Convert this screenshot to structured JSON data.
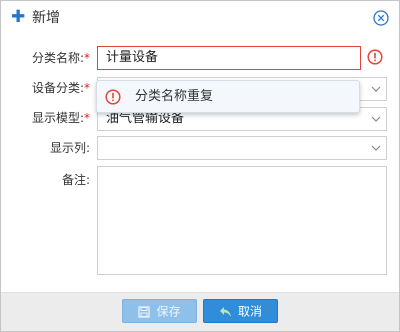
{
  "dialog": {
    "title": "新增",
    "close_icon": "close-circle-icon",
    "title_icon": "plus-icon"
  },
  "form": {
    "category_name": {
      "label": "分类名称:",
      "required_mark": "*",
      "value": "计量设备",
      "error": true
    },
    "device_category": {
      "label": "设备分类:",
      "required_mark": "*",
      "value": ""
    },
    "display_model": {
      "label": "显示模型:",
      "required_mark": "*",
      "value": "油气管输设备"
    },
    "display_columns": {
      "label": "显示列:",
      "value": ""
    },
    "remarks": {
      "label": "备注:",
      "value": ""
    }
  },
  "tooltip": {
    "message": "分类名称重复"
  },
  "footer": {
    "save_label": "保存",
    "cancel_label": "取消"
  },
  "colors": {
    "accent": "#2f8ddc",
    "error": "#e0463c"
  }
}
